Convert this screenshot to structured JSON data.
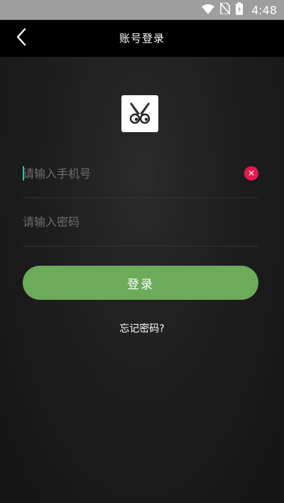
{
  "status_bar": {
    "time": "4:48",
    "icons": [
      "wifi-icon",
      "no-sim-icon",
      "battery-charging-icon"
    ]
  },
  "app_bar": {
    "title": "账号登录",
    "back_icon": "back-arrow-icon"
  },
  "logo": {
    "icon": "scissors-eyes-logo"
  },
  "form": {
    "phone": {
      "placeholder": "请输入手机号",
      "value": "",
      "clear_icon": "clear-icon"
    },
    "password": {
      "placeholder": "请输入密码",
      "value": ""
    },
    "login_label": "登录",
    "forgot_label": "忘记密码?"
  },
  "colors": {
    "accent": "#6bab5a",
    "clear": "#e8194f",
    "caret": "#2ec4b6",
    "app_bar": "#000000",
    "status_bar": "#9e9e9e"
  }
}
